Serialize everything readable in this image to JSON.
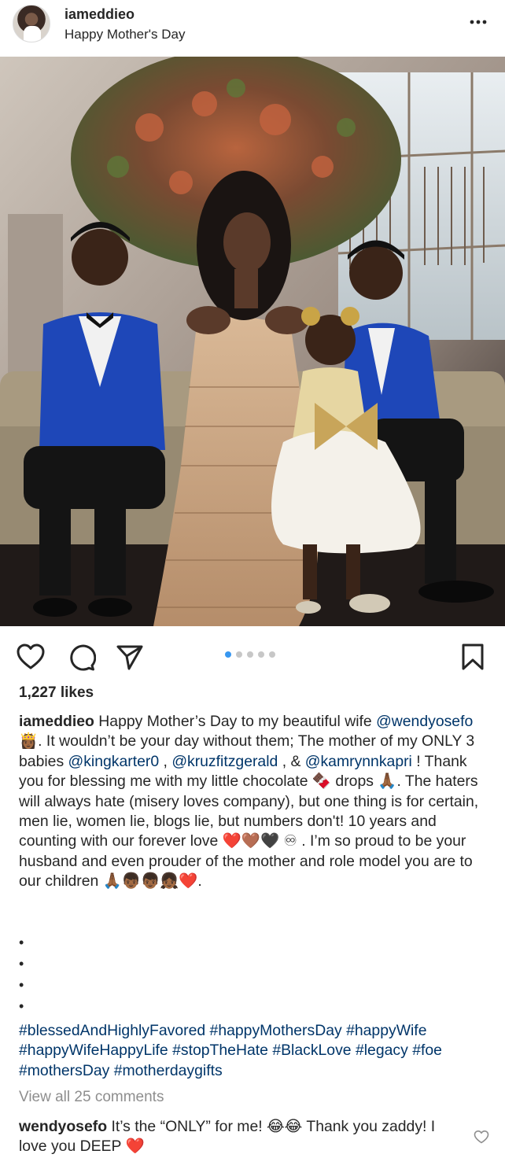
{
  "post": {
    "username": "iameddieo",
    "location": "Happy Mother's Day",
    "likes": "1,227 likes",
    "carousel": {
      "count": 5,
      "active": 1
    }
  },
  "caption": {
    "username": "iameddieo",
    "t1": " Happy Mother’s Day to my beautiful wife ",
    "m1": "@wendyosefo",
    "e1": " 👸🏾",
    "t2": ". It wouldn’t be your day without them; The mother of my ONLY 3 babies ",
    "m2": "@kingkarter0",
    "t3": " , ",
    "m3": "@kruzfitzgerald",
    "t4": " , & ",
    "m4": "@kamrynnkapri",
    "t5": " !  Thank you for blessing me with my little chocolate 🍫 drops 🙏🏾. The haters will always hate (misery loves company), but one thing is for certain, men lie, women lie, blogs lie, but numbers don't! 10 years and counting with our forever love ❤️🤎🖤 ♾ . I’m so proud to be your husband and even prouder of the mother and role model you are to our children 🙏🏾👦🏾👦🏾👧🏾❤️.",
    "bullet": "•"
  },
  "hashtags": [
    "#blessedAndHighlyFavored",
    "#happyMothersDay",
    "#happyWife",
    "#happyWifeHappyLife",
    "#stopTheHate",
    "#BlackLove",
    "#legacy",
    "#foe",
    "#mothersDay",
    "#motherdaygifts"
  ],
  "comments": {
    "view_all": "View all 25 comments",
    "top": {
      "username": "wendyosefo",
      "text": " It’s the “ONLY” for me! 😂😂 Thank you zaddy! I love you DEEP ❤️"
    }
  },
  "colors": {
    "link": "#003569",
    "text": "#262626",
    "muted": "#8e8e8e",
    "carousel_active": "#3897f0"
  },
  "icons": [
    "more-icon",
    "heart-icon",
    "comment-icon",
    "share-icon",
    "bookmark-icon"
  ]
}
